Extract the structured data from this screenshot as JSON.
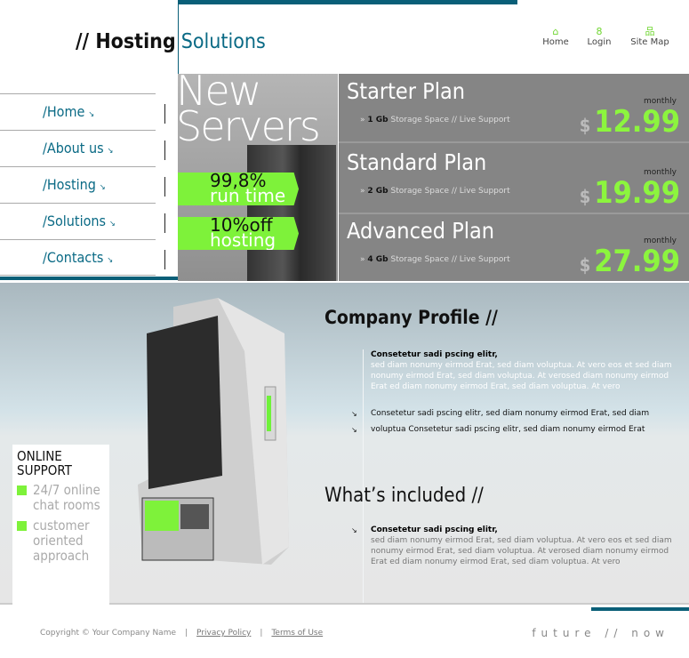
{
  "logo": {
    "part1": "// Hosting",
    "part2": "Solutions"
  },
  "top_nav": [
    {
      "label": "Home",
      "icon": "home-icon"
    },
    {
      "label": "Login",
      "icon": "users-icon"
    },
    {
      "label": "Site Map",
      "icon": "sitemap-icon"
    }
  ],
  "nav": [
    {
      "label": "/Home"
    },
    {
      "label": "/About us"
    },
    {
      "label": "/Hosting"
    },
    {
      "label": "/Solutions"
    },
    {
      "label": "/Contacts"
    }
  ],
  "promo": {
    "title1": "New",
    "title2": "Servers",
    "badge1_top": "99,8%",
    "badge1_bottom": "run time",
    "badge2_top": "10%off",
    "badge2_bottom": "hosting"
  },
  "plans": [
    {
      "name": "Starter Plan",
      "size": "1 Gb",
      "features": "Storage Space // Live Support",
      "period": "monthly",
      "currency": "$",
      "price": "12.99"
    },
    {
      "name": "Standard Plan",
      "size": "2 Gb",
      "features": "Storage Space // Live Support",
      "period": "monthly",
      "currency": "$",
      "price": "19.99"
    },
    {
      "name": "Advanced Plan",
      "size": "4 Gb",
      "features": "Storage Space // Live Support",
      "period": "monthly",
      "currency": "$",
      "price": "27.99"
    }
  ],
  "support": {
    "title": "ONLINE SUPPORT",
    "items": [
      "24/7 online chat rooms",
      "customer oriented approach"
    ]
  },
  "profile": {
    "title": "Company Profile //",
    "lead": "Consetetur sadi pscing elitr,",
    "body": "sed diam nonumy eirmod Erat, sed diam voluptua. At vero eos et sed diam nonumy eirmod Erat, sed diam voluptua. At verosed diam nonumy eirmod Erat ed diam nonumy eirmod Erat, sed diam voluptua. At vero",
    "bullets": [
      "Consetetur sadi pscing elitr, sed diam nonumy eirmod Erat, sed diam",
      "voluptua Consetetur sadi pscing elitr, sed diam nonumy eirmod Erat"
    ]
  },
  "included": {
    "title": "What’s included //",
    "lead": "Consetetur sadi pscing elitr,",
    "body": "sed diam nonumy eirmod Erat, sed diam voluptua. At vero eos et sed diam nonumy eirmod Erat, sed diam voluptua. At verosed diam nonumy eirmod Erat ed diam nonumy eirmod Erat, sed diam voluptua. At vero"
  },
  "footer": {
    "copyright": "Copyright © Your Company Name",
    "privacy": "Privacy Policy",
    "terms": "Terms of Use",
    "slogan": "future // now"
  },
  "colors": {
    "accent": "#0a5f78",
    "green": "#7ef23a"
  }
}
